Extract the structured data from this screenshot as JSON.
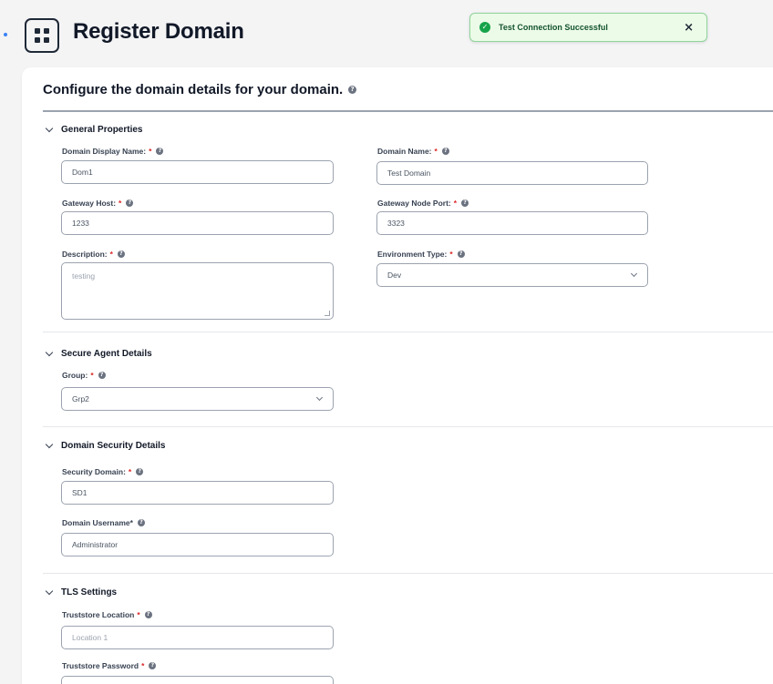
{
  "header": {
    "title": "Register Domain"
  },
  "toast": {
    "message": "Test Connection Successful",
    "close": "×"
  },
  "card": {
    "heading": "Configure the domain details for your domain."
  },
  "general": {
    "title": "General Properties",
    "display_name": {
      "label": "Domain Display Name:",
      "value": "Dom1"
    },
    "domain_name": {
      "label": "Domain Name:",
      "value": "Test Domain"
    },
    "gateway_host": {
      "label": "Gateway Host:",
      "value": "1233"
    },
    "gateway_port": {
      "label": "Gateway Node Port:",
      "value": "3323"
    },
    "description": {
      "label": "Description:",
      "value": "testing"
    },
    "environment": {
      "label": "Environment Type:",
      "value": "Dev"
    }
  },
  "agent": {
    "title": "Secure Agent Details",
    "group": {
      "label": "Group:",
      "value": "Grp2"
    }
  },
  "security": {
    "title": "Domain Security Details",
    "security_domain": {
      "label": "Security Domain:",
      "value": "SD1"
    },
    "username": {
      "label": "Domain Username*",
      "value": "Administrator"
    }
  },
  "tls": {
    "title": "TLS Settings",
    "truststore_location": {
      "label": "Truststore Location",
      "placeholder": "Location 1"
    },
    "truststore_password": {
      "label": "Truststore Password"
    }
  },
  "required_marker": "*",
  "help_glyph": "?",
  "colors": {
    "required": "#dc2626",
    "toast_bg": "#ecfbe8",
    "toast_border": "#8fd49a",
    "success": "#16a34a"
  }
}
